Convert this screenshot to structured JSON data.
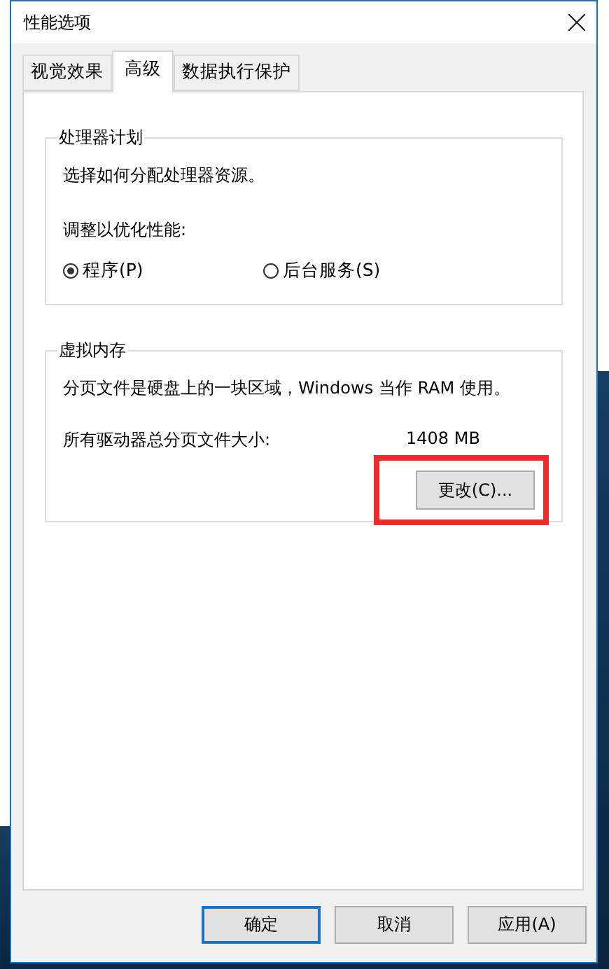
{
  "window": {
    "title": "性能选项"
  },
  "tabs": [
    {
      "label": "视觉效果",
      "selected": false
    },
    {
      "label": "高级",
      "selected": true
    },
    {
      "label": "数据执行保护",
      "selected": false
    }
  ],
  "processor_group": {
    "title": "处理器计划",
    "description": "选择如何分配处理器资源。",
    "adjust_label": "调整以优化性能:",
    "options": [
      {
        "label": "程序(P)",
        "selected": true
      },
      {
        "label": "后台服务(S)",
        "selected": false
      }
    ]
  },
  "virtual_memory_group": {
    "title": "虚拟内存",
    "description": "分页文件是硬盘上的一块区域，Windows 当作 RAM 使用。",
    "size_label": "所有驱动器总分页文件大小:",
    "size_value": "1408 MB",
    "change_button": {
      "label": "更改(C)...",
      "highlighted": true
    }
  },
  "buttons": [
    {
      "label": "确定",
      "default": true
    },
    {
      "label": "取消",
      "default": false
    },
    {
      "label": "应用(A)",
      "default": false
    }
  ]
}
